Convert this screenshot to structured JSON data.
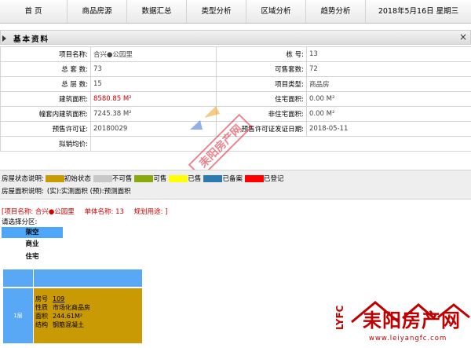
{
  "nav": {
    "items": [
      "首  页",
      "商品房源",
      "数据汇总",
      "类型分析",
      "区域分析",
      "趋势分析"
    ],
    "date": "2018年5月16日   星期三"
  },
  "section": {
    "title": "基本资料",
    "close": "×"
  },
  "info": {
    "rows": [
      [
        {
          "label": "项目名称:",
          "value": "合兴●公园里"
        },
        {
          "label": "栋    号:",
          "value": "13"
        }
      ],
      [
        {
          "label": "总 套 数:",
          "value": "73"
        },
        {
          "label": "可售套数:",
          "value": "72"
        }
      ],
      [
        {
          "label": "总 层 数:",
          "value": "15"
        },
        {
          "label": "项目类型:",
          "value": "商品房"
        }
      ],
      [
        {
          "label": "建筑面积:",
          "value": "8580.85 M²"
        },
        {
          "label": "住宅面积:",
          "value": "0.00 M²"
        }
      ],
      [
        {
          "label": "幢套内建筑面积:",
          "value": "7245.38 M²"
        },
        {
          "label": "非住宅面积:",
          "value": "0.00 M²"
        }
      ],
      [
        {
          "label": "预售许可证:",
          "value": "20180029"
        },
        {
          "label": "预售许可证发证日期:",
          "value": "2018-05-11"
        }
      ],
      [
        {
          "label": "拟销均价:",
          "value": ""
        }
      ]
    ]
  },
  "legend": {
    "status_label": "房屋状态说明:",
    "statuses": [
      {
        "name": "初始状态",
        "color": "#c89c02"
      },
      {
        "name": "不可售",
        "color": "#c8c8c8"
      },
      {
        "name": "可售",
        "color": "#8aaa0c"
      },
      {
        "name": "已售",
        "color": "#ffff00"
      },
      {
        "name": "已备案",
        "color": "#2b7bb0"
      },
      {
        "name": "已登记",
        "color": "#ff0000"
      }
    ],
    "area_label": "房屋面积说明:",
    "area_desc": "(实):实测面积  (预):预测面积"
  },
  "project": {
    "name": "[项目名称: 合兴●公园里",
    "unit": "单体名称: 13",
    "plan": "规划用途: ]"
  },
  "choose_label": "请选择分区:",
  "zones": [
    "架空",
    "商业",
    "住宅"
  ],
  "unit_table": {
    "floor": "1层",
    "room_label": "房号",
    "room": "109",
    "nature_label": "性质",
    "nature": "市场化商品房",
    "area_label": "面积",
    "area": "244.61M²",
    "struct_label": "结构",
    "struct": "钢筋混凝土"
  },
  "watermark": {
    "site": "耒阳房产网",
    "brand": "耒阳房产网",
    "url": "www.leiyangfc.com",
    "lyfc": "LYFC"
  },
  "colors": {
    "zone_selected": "#4da6f7",
    "table_blue": "#59a8f5",
    "unit_gold": "#ca9a04",
    "red": "#d40000"
  }
}
